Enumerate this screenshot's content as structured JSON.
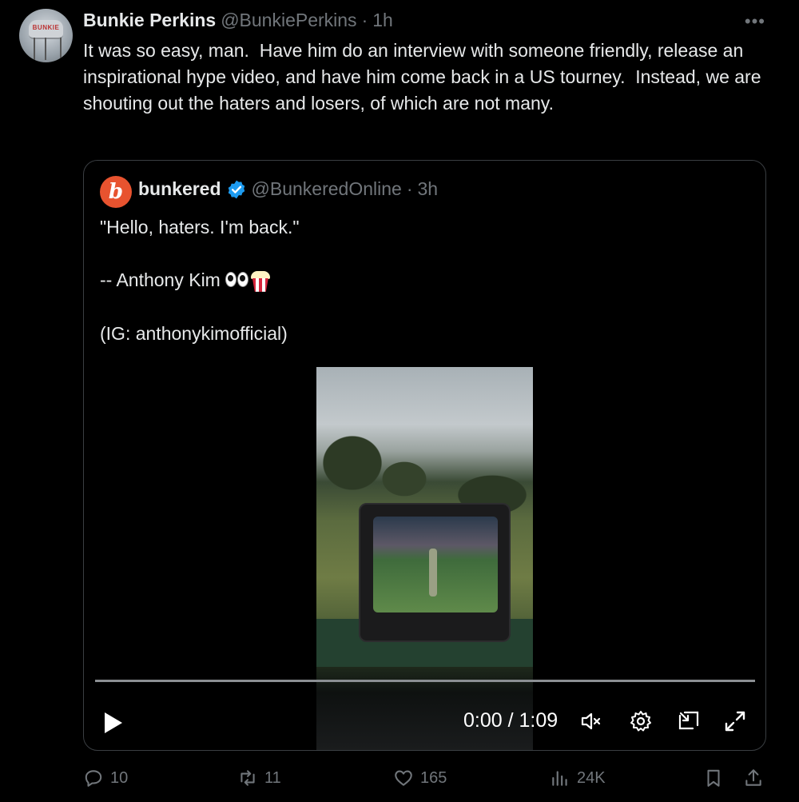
{
  "tweet": {
    "author_name": "Bunkie Perkins",
    "author_handle": "@BunkiePerkins",
    "separator": "·",
    "time": "1h",
    "more_label": "•••",
    "avatar_text": "BUNKIE",
    "text": "It was so easy, man.  Have him do an interview with someone friendly, release an inspirational hype video, and have him come back in a US tourney.  Instead, we are shouting out the haters and losers, of which are not many."
  },
  "quote": {
    "avatar_letter": "b",
    "author_name": "bunkered",
    "author_handle": "@BunkeredOnline",
    "separator": "·",
    "time": "3h",
    "line1": "\"Hello, haters. I'm back.\"",
    "line2": "-- Anthony Kim",
    "line3": "(IG: anthonykimofficial)",
    "video": {
      "time_readout": "0:00 / 1:09",
      "progress": 0,
      "muted": true
    }
  },
  "actions": {
    "replies": "10",
    "reposts": "11",
    "likes": "165",
    "views": "24K"
  },
  "colors": {
    "background": "#000000",
    "text": "#e7e9ea",
    "muted": "#71767b",
    "verified": "#1d9bf0",
    "bunkered_brand": "#e8532f"
  }
}
